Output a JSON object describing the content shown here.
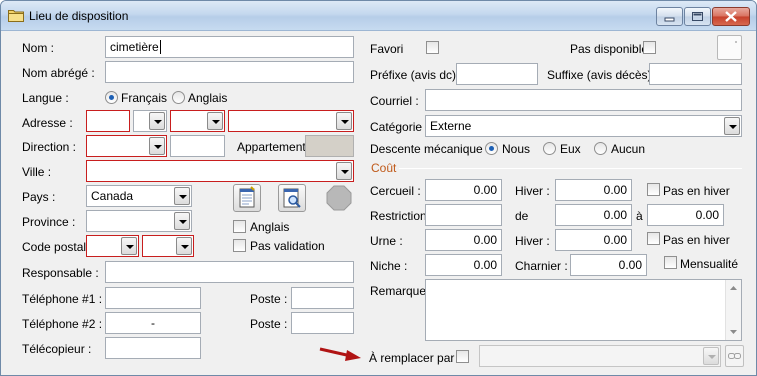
{
  "window": {
    "title": "Lieu de disposition",
    "icon": "folder-icon",
    "controls": [
      "minimize-icon",
      "maximize-icon",
      "close-icon"
    ]
  },
  "left": {
    "nom": {
      "label": "Nom :",
      "value": "cimetière"
    },
    "nom_abrege": {
      "label": "Nom abrégé :",
      "value": ""
    },
    "langue": {
      "label": "Langue :",
      "options": [
        "Français",
        "Anglais"
      ],
      "selected": "Français"
    },
    "adresse": {
      "label": "Adresse :"
    },
    "direction": {
      "label": "Direction :"
    },
    "appartement": {
      "label": "Appartement :"
    },
    "ville": {
      "label": "Ville :"
    },
    "pays": {
      "label": "Pays :",
      "value": "Canada"
    },
    "province": {
      "label": "Province :"
    },
    "code_postal": {
      "label": "Code postal :"
    },
    "anglais": {
      "label": "Anglais",
      "checked": false
    },
    "pas_validation": {
      "label": "Pas validation",
      "checked": false
    },
    "responsable": {
      "label": "Responsable :",
      "value": ""
    },
    "telephone1": {
      "label": "Téléphone #1 :",
      "value": "",
      "poste_label": "Poste :"
    },
    "telephone2": {
      "label": "Téléphone #2 :",
      "value": "-",
      "poste_label": "Poste :"
    },
    "telecopieur": {
      "label": "Télécopieur :",
      "value": ""
    },
    "toolbar_icons": [
      "notepad-icon",
      "document-search-icon",
      "stop-sign-icon"
    ]
  },
  "right": {
    "favori": {
      "label": "Favori",
      "checked": false
    },
    "pas_disponible": {
      "label": "Pas disponible",
      "checked": false
    },
    "prefixe": {
      "label": "Préfixe (avis dc) :",
      "value": ""
    },
    "suffixe": {
      "label": "Suffixe (avis décès) :",
      "value": ""
    },
    "courriel": {
      "label": "Courriel :",
      "value": ""
    },
    "categorie": {
      "label": "Catégorie :",
      "value": "Externe"
    },
    "descente": {
      "label": "Descente mécanique :",
      "options": [
        "Nous",
        "Eux",
        "Aucun"
      ],
      "selected": "Nous"
    },
    "cout": {
      "section_label": "Coût"
    },
    "cercueil": {
      "label": "Cercueil :",
      "value": "0.00"
    },
    "hiver1": {
      "label": "Hiver :",
      "value": "0.00"
    },
    "pas_en_hiver1": {
      "label": "Pas en hiver",
      "checked": false
    },
    "restriction": {
      "label": "Restriction :",
      "value": ""
    },
    "de": {
      "label": "de",
      "value": "0.00"
    },
    "a": {
      "label": "à",
      "value": "0.00"
    },
    "urne": {
      "label": "Urne :",
      "value": "0.00"
    },
    "hiver2": {
      "label": "Hiver :",
      "value": "0.00"
    },
    "pas_en_hiver2": {
      "label": "Pas en hiver",
      "checked": false
    },
    "niche": {
      "label": "Niche :",
      "value": "0.00"
    },
    "charnier": {
      "label": "Charnier :",
      "value": "0.00"
    },
    "mensualite": {
      "label": "Mensualité",
      "checked": false
    },
    "remarque": {
      "label": "Remarque :",
      "value": ""
    },
    "remplacer": {
      "label": "À remplacer par :",
      "checked": false,
      "value": ""
    }
  },
  "colors": {
    "required_border": "#c81e1e",
    "arrow": "#b01414",
    "radio_dot": "#1c5fb4"
  }
}
